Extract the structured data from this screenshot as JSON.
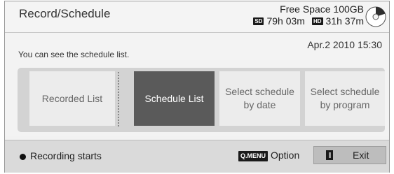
{
  "header": {
    "title": "Record/Schedule",
    "free_space": "Free Space 100GB",
    "sd_badge": "SD",
    "sd_time": "79h 03m",
    "hd_badge": "HD",
    "hd_time": "31h 37m",
    "disk_usage_fraction": 0.2
  },
  "body": {
    "datetime": "Apr.2 2010 15:30",
    "info": "You can see the schedule list.",
    "tabs": [
      {
        "label": "Recorded List",
        "active": false
      },
      {
        "label": "Schedule List",
        "active": true
      },
      {
        "label": "Select schedule by date",
        "active": false
      },
      {
        "label": "Select schedule by program",
        "active": false
      }
    ]
  },
  "footer": {
    "recording_label": "Recording starts",
    "qmenu_badge": "Q.MENU",
    "option_label": "Option",
    "exit_label": "Exit"
  }
}
